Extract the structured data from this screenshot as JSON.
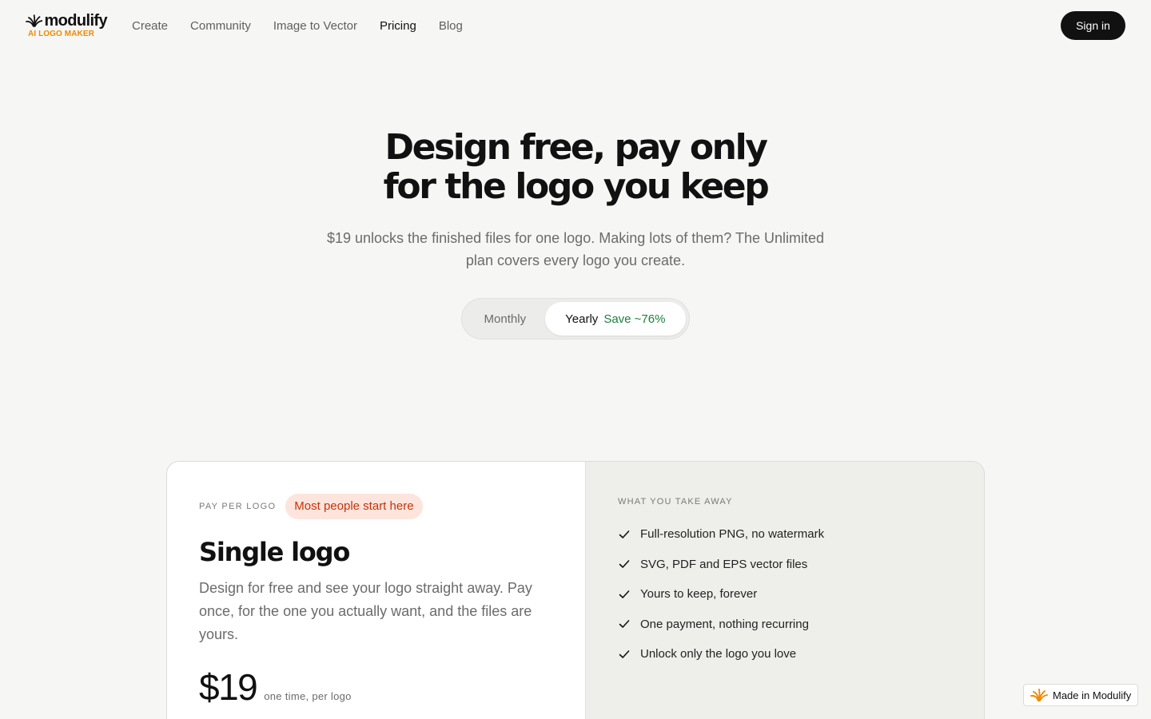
{
  "header": {
    "logo_word": "modulify",
    "logo_sub": "AI LOGO MAKER",
    "nav": [
      "Create",
      "Community",
      "Image to Vector",
      "Pricing",
      "Blog"
    ],
    "active_nav": "Pricing",
    "signin_label": "Sign in"
  },
  "hero": {
    "title_line1": "Design free, pay only",
    "title_line2": "for the logo you keep",
    "subtitle": "$19 unlocks the finished files for one logo. Making lots of them? The Unlimited plan covers every logo you create.",
    "toggle": {
      "monthly": "Monthly",
      "yearly": "Yearly",
      "save": "Save ~76%",
      "selected": "Yearly"
    }
  },
  "plan": {
    "eyebrow": "PAY PER LOGO",
    "badge": "Most people start here",
    "title": "Single logo",
    "description": "Design for free and see your logo straight away. Pay once, for the one you actually want, and the files are yours.",
    "price": "$19",
    "price_note": "one time, per logo"
  },
  "takeaway": {
    "title": "WHAT YOU TAKE AWAY",
    "features": [
      "Full-resolution PNG, no watermark",
      "SVG, PDF and EPS vector files",
      "Yours to keep, forever",
      "One payment, nothing recurring",
      "Unlock only the logo you love"
    ]
  },
  "made_in": "Made in Modulify",
  "colors": {
    "accent_orange": "#f08a00",
    "save_green": "#1a7f3c",
    "badge_text": "#c2350b",
    "badge_bg": "#fde4dc"
  }
}
